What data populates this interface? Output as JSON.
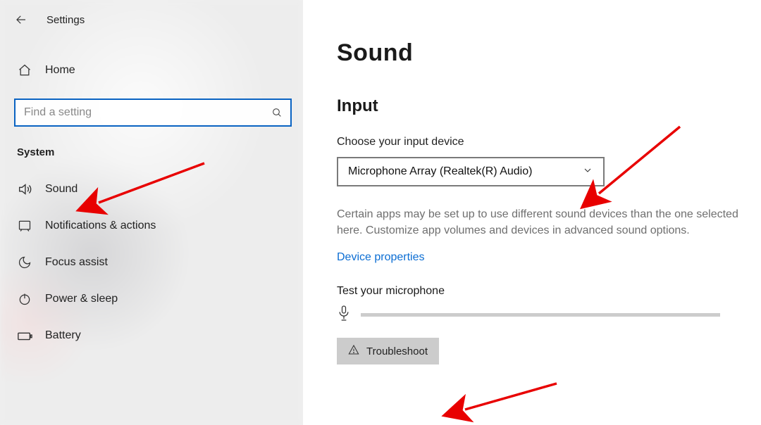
{
  "titlebar": {
    "title": "Settings"
  },
  "sidebar": {
    "home_label": "Home",
    "search_placeholder": "Find a setting",
    "group_label": "System",
    "items": [
      {
        "label": "Sound"
      },
      {
        "label": "Notifications & actions"
      },
      {
        "label": "Focus assist"
      },
      {
        "label": "Power & sleep"
      },
      {
        "label": "Battery"
      }
    ]
  },
  "main": {
    "page_title": "Sound",
    "section_title": "Input",
    "input_device_label": "Choose your input device",
    "input_device_value": "Microphone Array (Realtek(R) Audio)",
    "help_text": "Certain apps may be set up to use different sound devices than the one selected here. Customize app volumes and devices in advanced sound options.",
    "device_properties_link": "Device properties",
    "test_label": "Test your microphone",
    "troubleshoot_label": "Troubleshoot"
  }
}
